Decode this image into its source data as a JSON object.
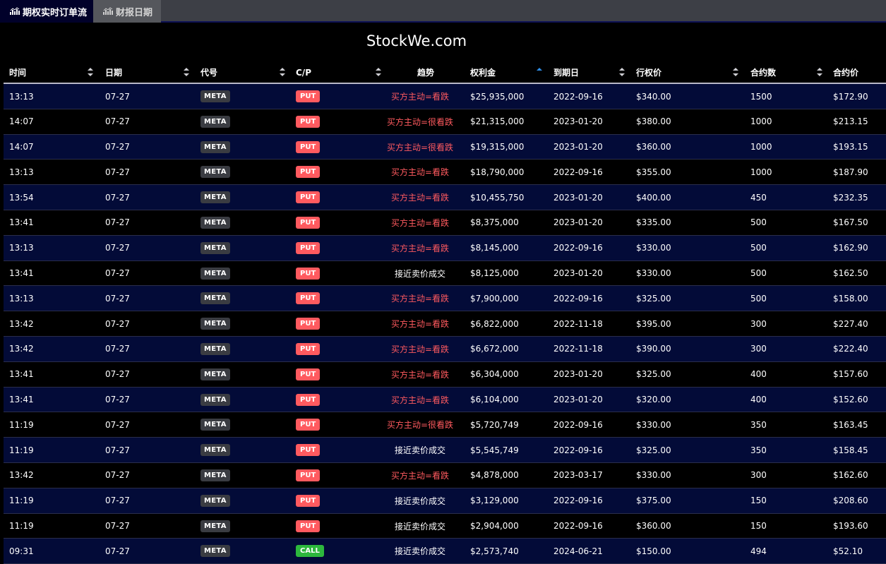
{
  "tabs": [
    {
      "label": "期权实时订单流",
      "active": true
    },
    {
      "label": "财报日期",
      "active": false
    }
  ],
  "brand": "StockWe.com",
  "columns": [
    "时间",
    "日期",
    "代号",
    "C/P",
    "趋势",
    "权利金",
    "到期日",
    "行权价",
    "合约数",
    "合约价"
  ],
  "sorted_column": "权利金",
  "colors": {
    "put": "#ff5a5f",
    "call": "#2db83d",
    "bearish_text": "#ff5a5f",
    "neutral_text": "#ffffff",
    "row_alt": "#030b38"
  },
  "rows": [
    {
      "time": "13:13",
      "date": "07-27",
      "ticker": "META",
      "cp": "PUT",
      "trend": "买方主动=看跌",
      "premium": "$25,935,000",
      "expiry": "2022-09-16",
      "strike": "$340.00",
      "contracts": "1500",
      "price": "$172.90"
    },
    {
      "time": "14:07",
      "date": "07-27",
      "ticker": "META",
      "cp": "PUT",
      "trend": "买方主动=很看跌",
      "premium": "$21,315,000",
      "expiry": "2023-01-20",
      "strike": "$380.00",
      "contracts": "1000",
      "price": "$213.15"
    },
    {
      "time": "14:07",
      "date": "07-27",
      "ticker": "META",
      "cp": "PUT",
      "trend": "买方主动=很看跌",
      "premium": "$19,315,000",
      "expiry": "2023-01-20",
      "strike": "$360.00",
      "contracts": "1000",
      "price": "$193.15"
    },
    {
      "time": "13:13",
      "date": "07-27",
      "ticker": "META",
      "cp": "PUT",
      "trend": "买方主动=看跌",
      "premium": "$18,790,000",
      "expiry": "2022-09-16",
      "strike": "$355.00",
      "contracts": "1000",
      "price": "$187.90"
    },
    {
      "time": "13:54",
      "date": "07-27",
      "ticker": "META",
      "cp": "PUT",
      "trend": "买方主动=看跌",
      "premium": "$10,455,750",
      "expiry": "2023-01-20",
      "strike": "$400.00",
      "contracts": "450",
      "price": "$232.35"
    },
    {
      "time": "13:41",
      "date": "07-27",
      "ticker": "META",
      "cp": "PUT",
      "trend": "买方主动=看跌",
      "premium": "$8,375,000",
      "expiry": "2023-01-20",
      "strike": "$335.00",
      "contracts": "500",
      "price": "$167.50"
    },
    {
      "time": "13:13",
      "date": "07-27",
      "ticker": "META",
      "cp": "PUT",
      "trend": "买方主动=看跌",
      "premium": "$8,145,000",
      "expiry": "2022-09-16",
      "strike": "$330.00",
      "contracts": "500",
      "price": "$162.90"
    },
    {
      "time": "13:41",
      "date": "07-27",
      "ticker": "META",
      "cp": "PUT",
      "trend": "接近卖价成交",
      "premium": "$8,125,000",
      "expiry": "2023-01-20",
      "strike": "$330.00",
      "contracts": "500",
      "price": "$162.50"
    },
    {
      "time": "13:13",
      "date": "07-27",
      "ticker": "META",
      "cp": "PUT",
      "trend": "买方主动=看跌",
      "premium": "$7,900,000",
      "expiry": "2022-09-16",
      "strike": "$325.00",
      "contracts": "500",
      "price": "$158.00"
    },
    {
      "time": "13:42",
      "date": "07-27",
      "ticker": "META",
      "cp": "PUT",
      "trend": "买方主动=看跌",
      "premium": "$6,822,000",
      "expiry": "2022-11-18",
      "strike": "$395.00",
      "contracts": "300",
      "price": "$227.40"
    },
    {
      "time": "13:42",
      "date": "07-27",
      "ticker": "META",
      "cp": "PUT",
      "trend": "买方主动=看跌",
      "premium": "$6,672,000",
      "expiry": "2022-11-18",
      "strike": "$390.00",
      "contracts": "300",
      "price": "$222.40"
    },
    {
      "time": "13:41",
      "date": "07-27",
      "ticker": "META",
      "cp": "PUT",
      "trend": "买方主动=看跌",
      "premium": "$6,304,000",
      "expiry": "2023-01-20",
      "strike": "$325.00",
      "contracts": "400",
      "price": "$157.60"
    },
    {
      "time": "13:41",
      "date": "07-27",
      "ticker": "META",
      "cp": "PUT",
      "trend": "买方主动=看跌",
      "premium": "$6,104,000",
      "expiry": "2023-01-20",
      "strike": "$320.00",
      "contracts": "400",
      "price": "$152.60"
    },
    {
      "time": "11:19",
      "date": "07-27",
      "ticker": "META",
      "cp": "PUT",
      "trend": "买方主动=很看跌",
      "premium": "$5,720,749",
      "expiry": "2022-09-16",
      "strike": "$330.00",
      "contracts": "350",
      "price": "$163.45"
    },
    {
      "time": "11:19",
      "date": "07-27",
      "ticker": "META",
      "cp": "PUT",
      "trend": "接近卖价成交",
      "premium": "$5,545,749",
      "expiry": "2022-09-16",
      "strike": "$325.00",
      "contracts": "350",
      "price": "$158.45"
    },
    {
      "time": "13:42",
      "date": "07-27",
      "ticker": "META",
      "cp": "PUT",
      "trend": "买方主动=看跌",
      "premium": "$4,878,000",
      "expiry": "2023-03-17",
      "strike": "$330.00",
      "contracts": "300",
      "price": "$162.60"
    },
    {
      "time": "11:19",
      "date": "07-27",
      "ticker": "META",
      "cp": "PUT",
      "trend": "接近卖价成交",
      "premium": "$3,129,000",
      "expiry": "2022-09-16",
      "strike": "$375.00",
      "contracts": "150",
      "price": "$208.60"
    },
    {
      "time": "11:19",
      "date": "07-27",
      "ticker": "META",
      "cp": "PUT",
      "trend": "接近卖价成交",
      "premium": "$2,904,000",
      "expiry": "2022-09-16",
      "strike": "$360.00",
      "contracts": "150",
      "price": "$193.60"
    },
    {
      "time": "09:31",
      "date": "07-27",
      "ticker": "META",
      "cp": "CALL",
      "trend": "接近卖价成交",
      "premium": "$2,573,740",
      "expiry": "2024-06-21",
      "strike": "$150.00",
      "contracts": "494",
      "price": "$52.10"
    }
  ]
}
